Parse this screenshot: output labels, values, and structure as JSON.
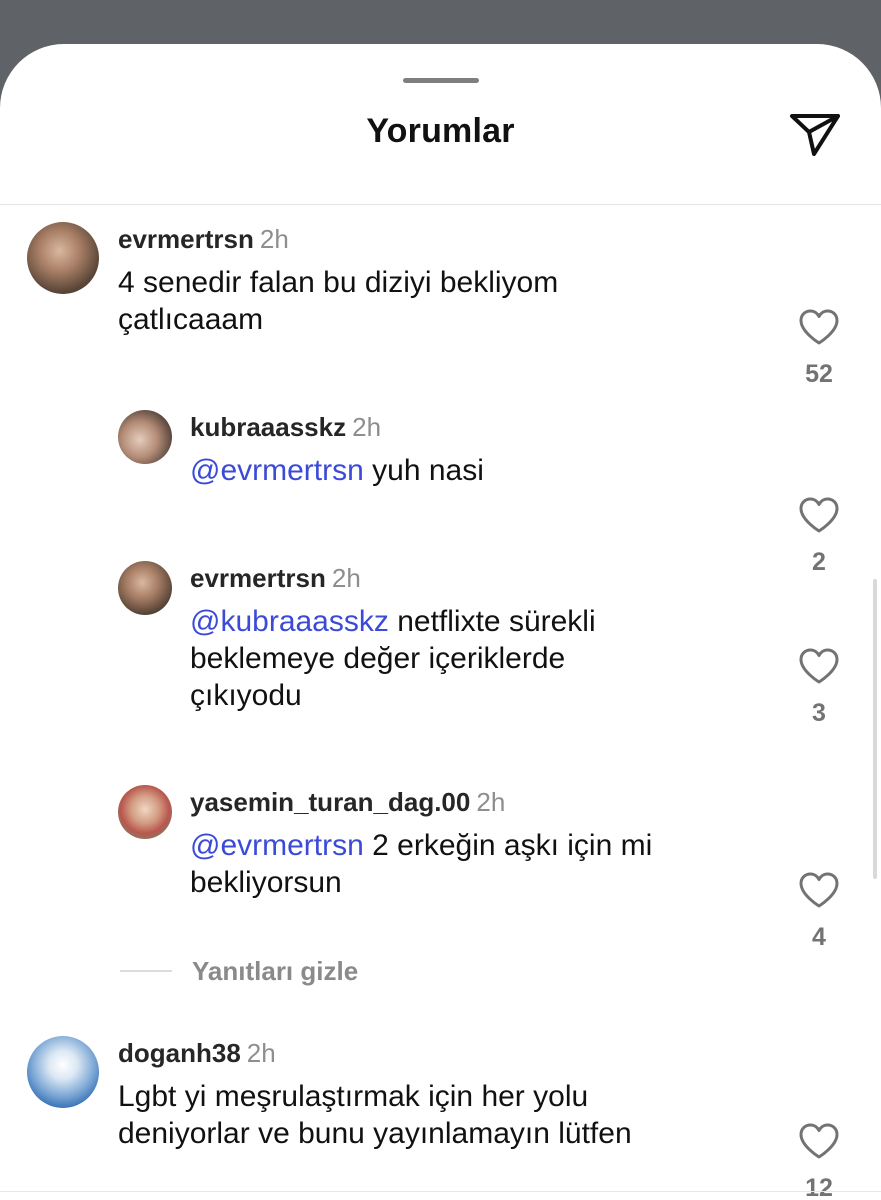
{
  "header": {
    "title": "Yorumlar"
  },
  "comments": [
    {
      "username": "evrmertrsn",
      "time": "2h",
      "mention": "",
      "text": "4 senedir falan bu diziyi bekliyom\nçatlıcaaam",
      "likes": "52"
    },
    {
      "username": "kubraaasskz",
      "time": "2h",
      "mention": "@evrmertrsn",
      "text": "yuh nasi",
      "likes": "2"
    },
    {
      "username": "evrmertrsn",
      "time": "2h",
      "mention": "@kubraaasskz",
      "text": "netflixte sürekli\nbeklemeye değer içeriklerde\nçıkıyodu",
      "likes": "3"
    },
    {
      "username": "yasemin_turan_dag.00",
      "time": "2h",
      "mention": "@evrmertrsn",
      "text": "2 erkeğin aşkı için mi\nbekliyorsun",
      "likes": "4"
    },
    {
      "username": "doganh38",
      "time": "2h",
      "mention": "",
      "text": "Lgbt yi meşrulaştırmak için her yolu\ndeniyorlar ve bunu yayınlamayın lütfen",
      "likes": "12"
    }
  ],
  "replies_toggle": {
    "label": "Yanıtları gizle"
  },
  "colors": {
    "mention": "#3b4bd8",
    "overlay": "#5f6368",
    "like_count": "#737373"
  },
  "icons": {
    "send": "paper-plane-icon",
    "like": "heart-outline-icon"
  }
}
